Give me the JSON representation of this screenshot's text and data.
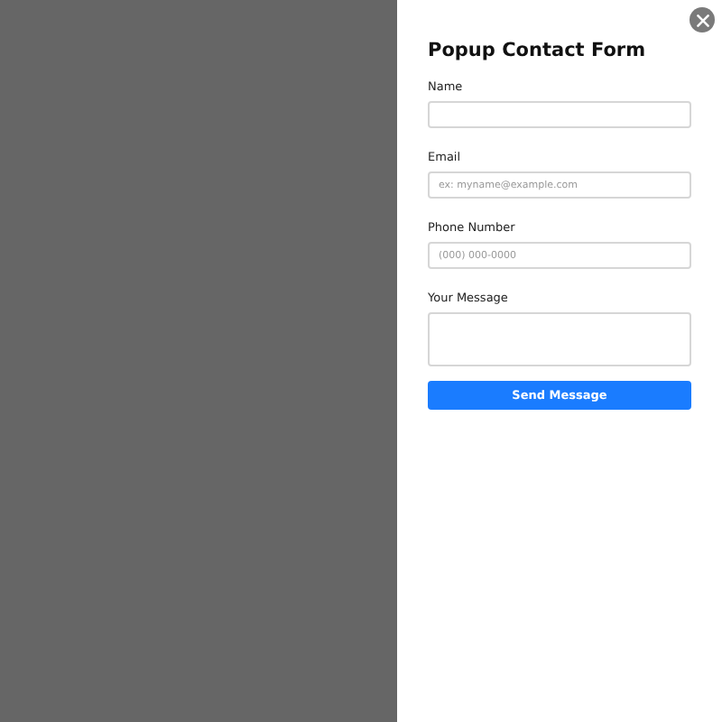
{
  "title": "Popup Contact Form",
  "fields": [
    {
      "label": "Name",
      "kind": "input"
    },
    {
      "label": "Email",
      "kind": "input",
      "placeholder": "ex: myname@example.com"
    },
    {
      "label": "Phone Number",
      "kind": "input",
      "placeholder": "(000) 000-0000"
    },
    {
      "label": "Your Message",
      "kind": "textarea"
    }
  ],
  "submit": "Send Message"
}
